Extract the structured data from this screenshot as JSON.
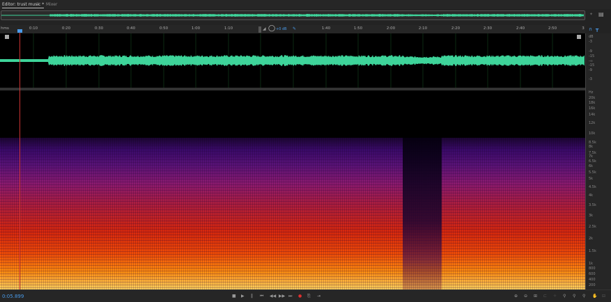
{
  "tabs": [
    {
      "label": "Editor: trust music *"
    },
    {
      "label": "Mixer"
    }
  ],
  "ruler": {
    "unit": "hms",
    "ticks": [
      "0:10",
      "0:20",
      "0:30",
      "0:40",
      "0:50",
      "1:00",
      "1:10",
      "1:40",
      "1:50",
      "2:00",
      "2:10",
      "2:20",
      "2:30",
      "2:40",
      "2:50",
      "3"
    ],
    "volume": "+0 dB"
  },
  "db_scale": [
    "dB",
    "-3",
    "-9",
    "-15",
    "-∞",
    "-15",
    "-9",
    "-3"
  ],
  "hz_scale": [
    "Hz",
    "20k",
    "18k",
    "16k",
    "14k",
    "12k",
    "10k",
    "8.5k",
    "8k",
    "7.5k",
    "7k",
    "6.5k",
    "6k",
    "5.5k",
    "5k",
    "4.5k",
    "4k",
    "3.5k",
    "3k",
    "2.5k",
    "2k",
    "1.5k",
    "1k",
    "800",
    "600",
    "400",
    "200"
  ],
  "transport": {
    "time": "0:05.899"
  },
  "colors": {
    "waveform": "#3ed49a",
    "accent": "#4a9ae8",
    "playhead": "#cc3333"
  }
}
